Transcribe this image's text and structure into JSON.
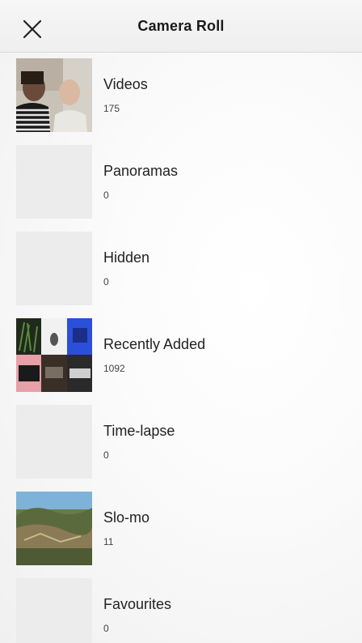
{
  "header": {
    "title": "Camera Roll"
  },
  "albums": [
    {
      "label": "Videos",
      "count": "175"
    },
    {
      "label": "Panoramas",
      "count": "0"
    },
    {
      "label": "Hidden",
      "count": "0"
    },
    {
      "label": "Recently Added",
      "count": "1092"
    },
    {
      "label": "Time-lapse",
      "count": "0"
    },
    {
      "label": "Slo-mo",
      "count": "11"
    },
    {
      "label": "Favourites",
      "count": "0"
    }
  ],
  "colors": {
    "header_bg": "#f2f2f2",
    "text": "#222222",
    "placeholder": "#ececec"
  }
}
